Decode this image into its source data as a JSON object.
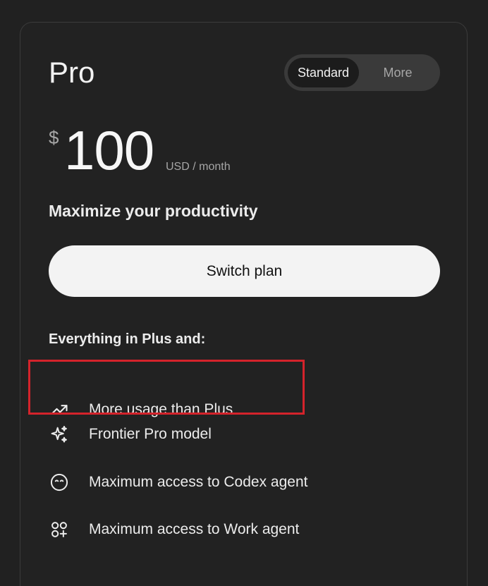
{
  "plan": {
    "name": "Pro",
    "toggle": {
      "options": [
        "Standard",
        "More"
      ],
      "selected": "Standard"
    },
    "price": {
      "currency_symbol": "$",
      "amount": "100",
      "period": "USD / month"
    },
    "tagline": "Maximize your productivity",
    "action_label": "Switch plan"
  },
  "features": {
    "heading": "Everything in Plus and:",
    "items": [
      {
        "icon": "trending-up-icon",
        "label": "More usage than Plus",
        "highlighted": true
      },
      {
        "icon": "sparkles-icon",
        "label": "Frontier Pro model",
        "highlighted": false
      },
      {
        "icon": "codex-icon",
        "label": "Maximum access to Codex agent",
        "highlighted": false
      },
      {
        "icon": "agent-icon",
        "label": "Maximum access to Work agent",
        "highlighted": false
      }
    ]
  },
  "colors": {
    "background": "#212121",
    "card_border": "#3b3b3b",
    "toggle_track": "#3a3a3a",
    "toggle_active": "#1c1c1c",
    "button_bg": "#f3f3f3",
    "highlight_border": "#d4232b"
  }
}
